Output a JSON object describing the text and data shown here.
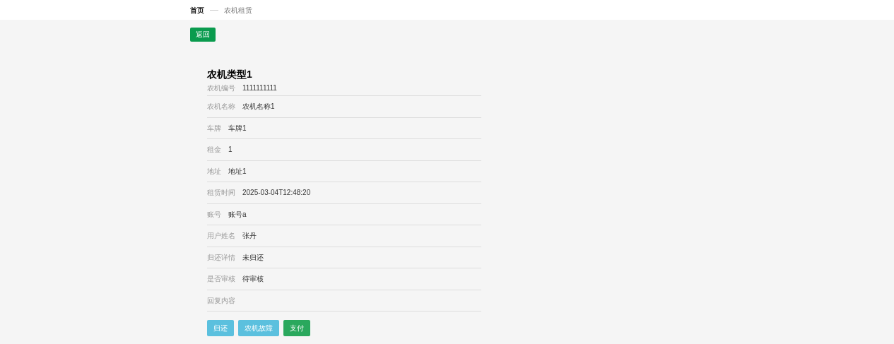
{
  "breadcrumb": [
    {
      "label": "首页",
      "selected": false
    },
    {
      "label": "农机租赁",
      "selected": true
    }
  ],
  "back_button": "返回",
  "title": "农机类型1",
  "fields": [
    {
      "label": "农机编号",
      "value": "1111111111"
    },
    {
      "label": "农机名称",
      "value": "农机名称1"
    },
    {
      "label": "车牌",
      "value": "车牌1"
    },
    {
      "label": "租金",
      "value": "1"
    },
    {
      "label": "地址",
      "value": "地址1"
    },
    {
      "label": "租赁时间",
      "value": "2025-03-04T12:48:20"
    },
    {
      "label": "账号",
      "value": "账号a"
    },
    {
      "label": "用户姓名",
      "value": "张丹"
    },
    {
      "label": "归还详情",
      "value": "未归还"
    },
    {
      "label": "是否审核",
      "value": "待审核"
    },
    {
      "label": "回复内容"
    }
  ],
  "actions": [
    {
      "label": "归还",
      "kind": "info"
    },
    {
      "label": "农机故障",
      "kind": "info"
    },
    {
      "label": "支付",
      "kind": "success"
    }
  ]
}
